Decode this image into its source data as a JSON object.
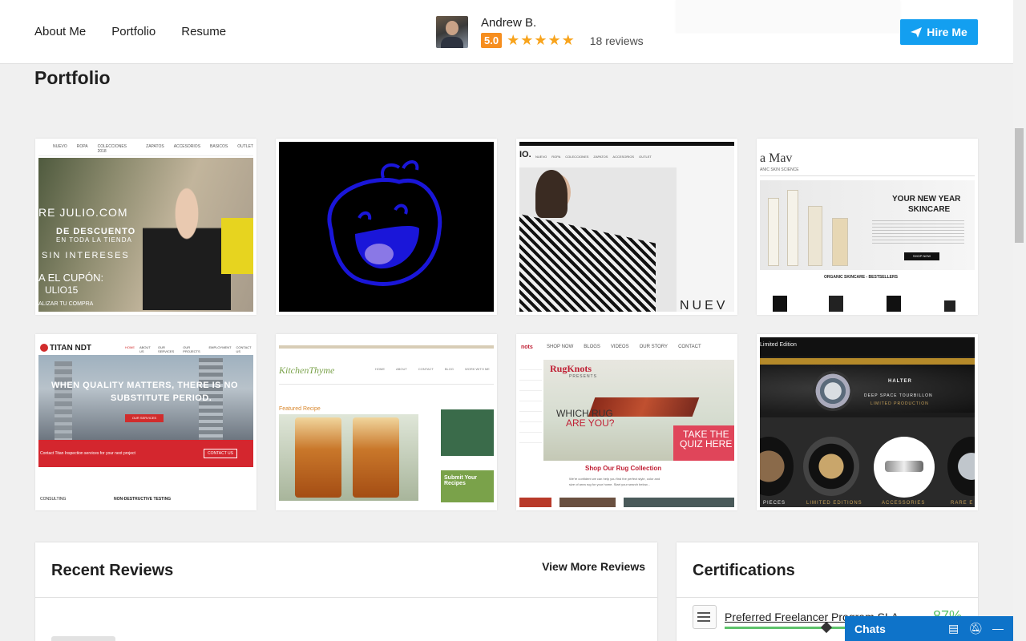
{
  "nav": {
    "about": "About Me",
    "portfolio": "Portfolio",
    "resume": "Resume"
  },
  "profile": {
    "name": "Andrew B.",
    "score": "5.0",
    "stars": "★★★★★",
    "reviews": "18 reviews"
  },
  "hire": {
    "label": "Hire Me",
    "icon": "paper-plane-icon"
  },
  "portfolio_title": "Portfolio",
  "tiles": [
    {
      "name": "fashion-julio-site",
      "bg": "#cfc6b4",
      "texts": [
        "RE JULIO.COM",
        "DE DESCUENTO",
        "EN TODA LA TIENDA",
        "SIN INTERESES",
        "A EL CUPÓN:",
        "ULIO15",
        "ALIZAR TU COMPRA"
      ],
      "menu": [
        "NUEVO",
        "ROPA",
        "COLECCIONES 2018",
        "ZAPATOS",
        "ACCESORIOS",
        "BASICOS",
        "OUTLET"
      ]
    },
    {
      "name": "blue-face-animation",
      "bg": "#000000",
      "texts": []
    },
    {
      "name": "fashion-model-site",
      "bg": "#f4f4f4",
      "texts": [
        "IO.",
        "NUEV"
      ],
      "menu": [
        "NUEVO",
        "ROPA",
        "COLECCIONES",
        "ZAPATOS",
        "ACCESORIOS",
        "OUTLET"
      ]
    },
    {
      "name": "skincare-site",
      "bg": "#ffffff",
      "texts": [
        "a Mav",
        "ANIC SKIN SCIENCE",
        "YOUR NEW YEAR",
        "SKINCARE",
        "SHOP NOW",
        "ORGANIC SKINCARE - BESTSELLERS"
      ],
      "menu": []
    },
    {
      "name": "titan-ndt-site",
      "bg": "#cfd6dc",
      "texts": [
        "TITAN NDT",
        "WHEN QUALITY MATTERS, THERE IS NO",
        "SUBSTITUTE PERIOD.",
        "OUR SERVICES",
        "Contact Titan Inspection services for your next project",
        "CONTACT US",
        "CONSULTING",
        "NON-DESTRUCTIVE TESTING"
      ],
      "menu": [
        "HOME",
        "ABOUT US",
        "OUR SERVICES",
        "OUR PROJECTS",
        "EMPLOYMENT",
        "CONTACT US"
      ]
    },
    {
      "name": "kitchen-thyme-site",
      "bg": "#ffffff",
      "texts": [
        "KitchenThyme",
        "Featured Recipe",
        "Submit Your Recipes"
      ],
      "menu": [
        "HOME",
        "ABOUT",
        "CONTACT",
        "BLOG",
        "WORK WITH ME"
      ]
    },
    {
      "name": "rugknots-site",
      "bg": "#ffffff",
      "texts": [
        "nots",
        "RugKnots",
        "PRESENTS",
        "WHICH RUG",
        "ARE YOU?",
        "TAKE THE",
        "QUIZ HERE",
        "Shop Our Rug Collection",
        "We're confident we can help you find the perfect style, color and",
        "size of area rug for your home. Start your search below..."
      ],
      "menu": [
        "SHOP NOW",
        "BLOGS",
        "VIDEOS",
        "OUR STORY",
        "CONTACT"
      ]
    },
    {
      "name": "watches-site",
      "bg": "#1a1a1a",
      "texts": [
        "Limited Edition",
        "HALTER",
        "DEEP SPACE TOURBILLON",
        "LIMITED PRODUCTION",
        "PIECES",
        "LIMITED EDITIONS",
        "ACCESSORIES",
        "RARE E"
      ],
      "menu": []
    }
  ],
  "reviews_card": {
    "title": "Recent Reviews",
    "link": "View More Reviews"
  },
  "cert_card": {
    "title": "Certifications",
    "item": "Preferred Freelancer Program SLA",
    "pct": "87%"
  },
  "chats": {
    "label": "Chats"
  }
}
